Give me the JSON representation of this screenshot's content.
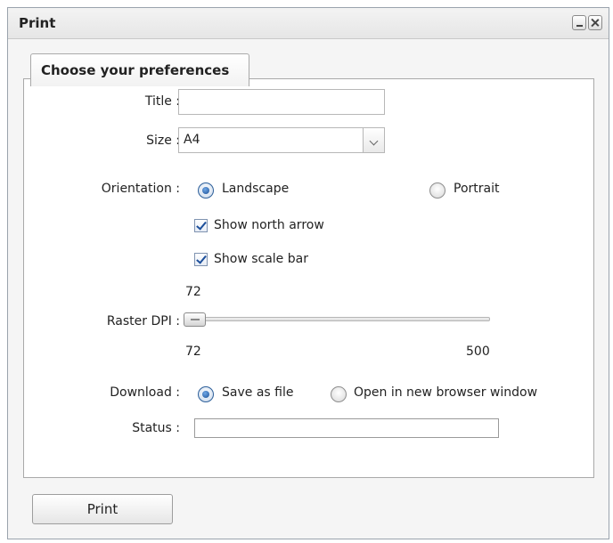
{
  "window": {
    "title": "Print"
  },
  "tab": {
    "label": "Choose your preferences"
  },
  "form": {
    "title_label": "Title :",
    "title_value": "",
    "size_label": "Size :",
    "size_value": "A4",
    "orientation_label": "Orientation :",
    "orientation_options": [
      {
        "label": "Landscape",
        "selected": true
      },
      {
        "label": "Portrait",
        "selected": false
      }
    ],
    "show_north_arrow": {
      "label": "Show north arrow",
      "checked": true
    },
    "show_scale_bar": {
      "label": "Show scale bar",
      "checked": true
    },
    "raster_dpi": {
      "label": "Raster DPI :",
      "current": "72",
      "min": "72",
      "max": "500",
      "value": 72
    },
    "download_label": "Download :",
    "download_options": [
      {
        "label": "Save as file",
        "selected": true
      },
      {
        "label": "Open in new browser window",
        "selected": false
      }
    ],
    "status_label": "Status :",
    "status_value": ""
  },
  "footer": {
    "print_label": "Print"
  },
  "colors": {
    "accent": "#1d4f9b",
    "border": "#a9a9a9"
  }
}
